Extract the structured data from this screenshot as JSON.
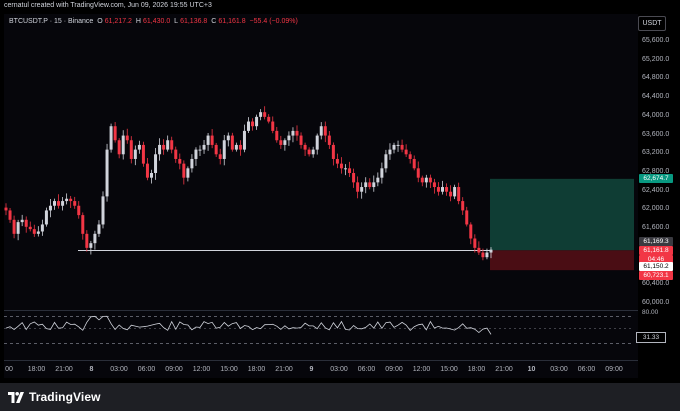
{
  "credit": "cernatul created with TradingView.com, Jun 09, 2026 19:55 UTC+3",
  "legend": {
    "symbol": "BTCUSDT.P · 15 · Binance",
    "o_label": "O",
    "o_value": "61,217.2",
    "h_label": "H",
    "h_value": "61,430.0",
    "l_label": "L",
    "l_value": "61,136.8",
    "c_label": "C",
    "c_value": "61,161.8",
    "change": "−55.4 (−0.09%)"
  },
  "currency": "USDT",
  "price_axis": [
    "65,600.0",
    "65,200.0",
    "64,800.0",
    "64,400.0",
    "64,000.0",
    "63,600.0",
    "63,200.0",
    "62,800.0",
    "62,400.0",
    "62,000.0",
    "61,600.0",
    "61,200.0",
    "60,800.0",
    "60,400.0",
    "60,000.0"
  ],
  "tags": {
    "tp": "62,674.7",
    "current_1": "61,169.3",
    "current_2": "61,161.8",
    "countdown": "04:46",
    "entry": "61,150.2",
    "sl": "60,723.1"
  },
  "rsi": {
    "top_label": "80.00",
    "value_label": "31.33"
  },
  "time_axis": [
    "00",
    "18:00",
    "21:00",
    "8",
    "03:00",
    "06:00",
    "09:00",
    "12:00",
    "15:00",
    "18:00",
    "21:00",
    "9",
    "03:00",
    "06:00",
    "09:00",
    "12:00",
    "15:00",
    "18:00",
    "21:00",
    "10",
    "03:00",
    "06:00",
    "09:00"
  ],
  "footer": {
    "brand": "TradingView"
  },
  "colors": {
    "up": "#d1d4dc",
    "down": "#f23645",
    "tp_zone": "#0f3d34",
    "sl_zone": "#4a0d14",
    "bg": "#06060b"
  },
  "chart_data": {
    "type": "candlestick",
    "title": "",
    "ylim": [
      60000,
      65800
    ],
    "y_ticks": [
      60000,
      60400,
      60800,
      61200,
      61600,
      62000,
      62400,
      62800,
      63200,
      63600,
      64000,
      64400,
      64800,
      65200,
      65600
    ],
    "closes": [
      62000,
      61800,
      61500,
      61750,
      61800,
      61650,
      61600,
      61500,
      61550,
      61700,
      62000,
      62100,
      62200,
      62100,
      62200,
      62250,
      62200,
      62100,
      61900,
      61500,
      61200,
      61300,
      61500,
      61700,
      62300,
      63300,
      63800,
      63500,
      63200,
      63600,
      63500,
      63100,
      63300,
      63400,
      63000,
      62700,
      62800,
      63200,
      63400,
      63300,
      63500,
      63300,
      63100,
      63000,
      62700,
      62900,
      63100,
      63300,
      63300,
      63400,
      63600,
      63400,
      63200,
      63100,
      63500,
      63600,
      63300,
      63400,
      63300,
      63700,
      63900,
      63800,
      64000,
      64100,
      64000,
      63900,
      63700,
      63500,
      63400,
      63500,
      63600,
      63700,
      63600,
      63400,
      63300,
      63200,
      63300,
      63600,
      63800,
      63600,
      63400,
      63100,
      63000,
      62900,
      62900,
      62800,
      62600,
      62400,
      62500,
      62600,
      62500,
      62600,
      62700,
      62900,
      63200,
      63300,
      63400,
      63400,
      63300,
      63200,
      63100,
      62900,
      62700,
      62600,
      62700,
      62600,
      62500,
      62400,
      62500,
      62400,
      62300,
      62500,
      62200,
      62000,
      61700,
      61400,
      61200,
      61100,
      61000,
      61100,
      61161.8
    ],
    "entry": 61150.2,
    "take_profit": 62674.7,
    "stop_loss": 60723.1,
    "rsi_upper": 80,
    "rsi_lower": 20,
    "rsi_current": 31.33
  }
}
